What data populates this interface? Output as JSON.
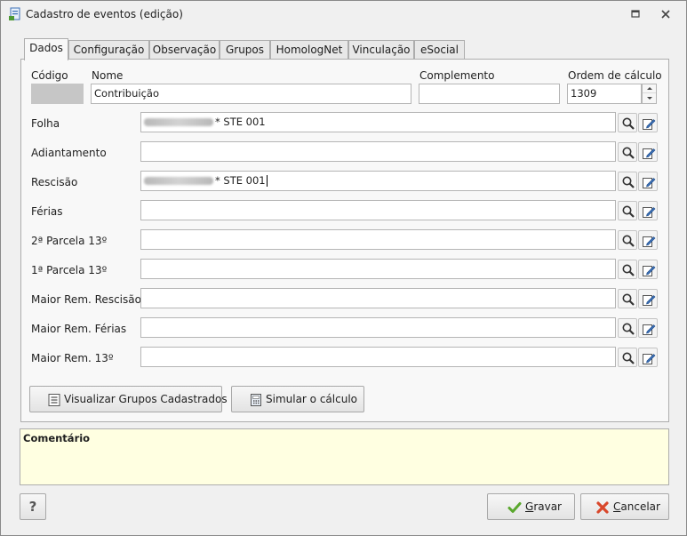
{
  "window": {
    "title": "Cadastro de eventos (edição)"
  },
  "tabs": [
    {
      "label": "Dados",
      "active": true
    },
    {
      "label": "Configuração"
    },
    {
      "label": "Observação"
    },
    {
      "label": "Grupos"
    },
    {
      "label": "HomologNet"
    },
    {
      "label": "Vinculação"
    },
    {
      "label": "eSocial"
    }
  ],
  "header_fields": {
    "codigo_label": "Código",
    "codigo_value": "",
    "nome_label": "Nome",
    "nome_value": "Contribuição",
    "complemento_label": "Complemento",
    "complemento_value": "",
    "ordem_label": "Ordem de cálculo",
    "ordem_value": "1309"
  },
  "rows": [
    {
      "label": "Folha",
      "value": "* STE 001",
      "redacted_prefix": true
    },
    {
      "label": "Adiantamento",
      "value": ""
    },
    {
      "label": "Rescisão",
      "value": "* STE 001",
      "redacted_prefix": true,
      "cursor": true
    },
    {
      "label": "Férias",
      "value": ""
    },
    {
      "label": "2ª Parcela 13º",
      "value": ""
    },
    {
      "label": "1ª Parcela 13º",
      "value": ""
    },
    {
      "label": "Maior Rem. Rescisão",
      "value": ""
    },
    {
      "label": "Maior Rem. Férias",
      "value": ""
    },
    {
      "label": "Maior Rem. 13º",
      "value": ""
    }
  ],
  "panel_buttons": {
    "visualizar": "Visualizar Grupos Cadastrados",
    "simular": "Simular o cálculo"
  },
  "comment": {
    "title": "Comentário"
  },
  "footer": {
    "help": "?",
    "gravar_mnemonic": "G",
    "gravar_rest": "ravar",
    "cancelar_mnemonic": "C",
    "cancelar_rest": "ancelar"
  },
  "colors": {
    "comment_bg": "#ffffe1",
    "ok_green": "#5aa72d",
    "cancel_red": "#d9472b",
    "icon_blue": "#3b6fb6"
  }
}
